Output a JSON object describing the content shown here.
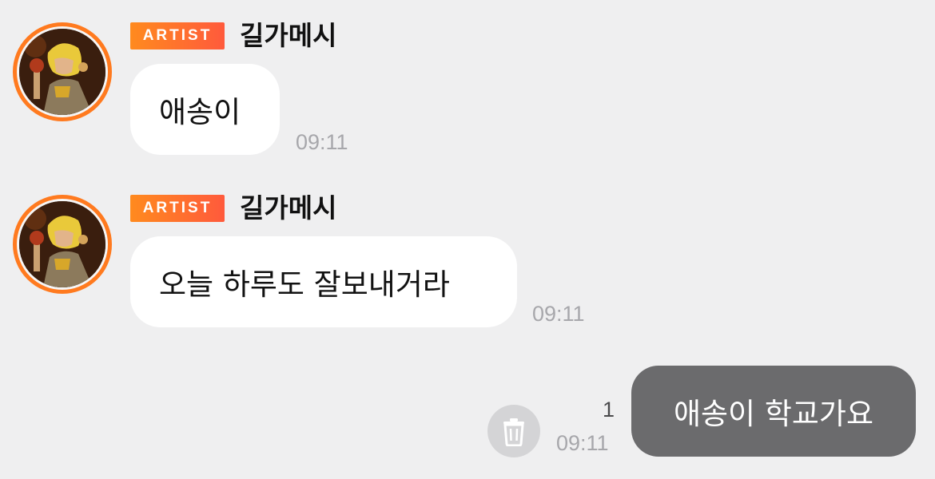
{
  "messages": [
    {
      "badge": "ARTIST",
      "sender": "길가메시",
      "text": "애송이",
      "time": "09:11"
    },
    {
      "badge": "ARTIST",
      "sender": "길가메시",
      "text": "오늘 하루도 잘보내거라",
      "time": "09:11"
    }
  ],
  "outgoing": {
    "text": "애송이 학교가요",
    "time": "09:11",
    "unread_count": "1"
  },
  "icons": {
    "delete": "trash-icon",
    "avatar": "profile-avatar"
  },
  "colors": {
    "badge_start": "#ff8a1e",
    "badge_end": "#ff5a3c",
    "avatar_ring": "#ff7a1f",
    "outgoing_bubble": "#6b6b6d",
    "background": "#efeff0"
  }
}
